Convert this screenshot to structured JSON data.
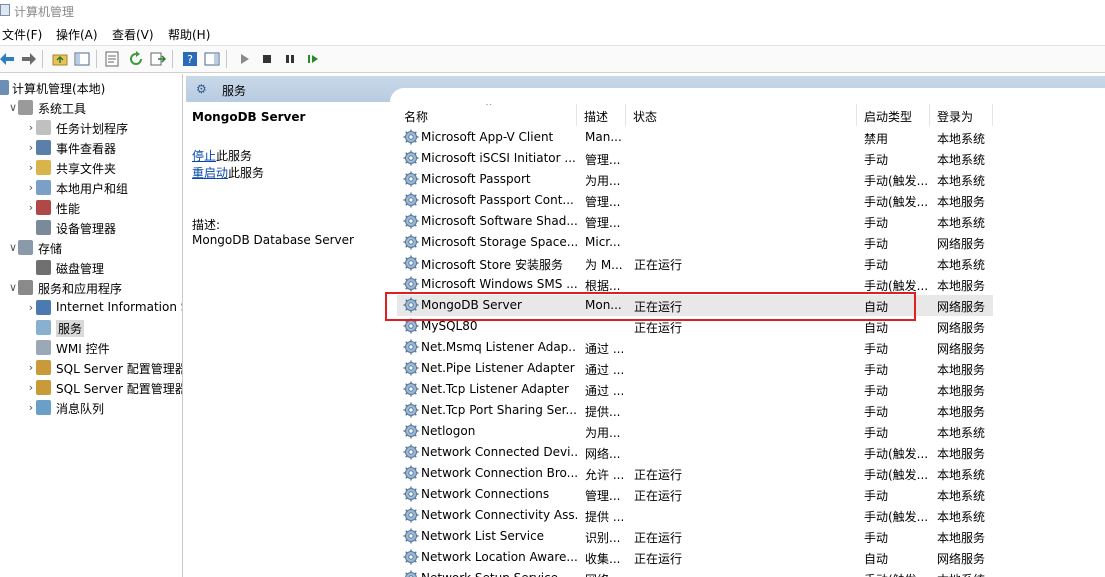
{
  "window": {
    "title": "计算机管理"
  },
  "menu": [
    "文件(F)",
    "操作(A)",
    "查看(V)",
    "帮助(H)"
  ],
  "tree": [
    {
      "label": "计算机管理(本地)",
      "level": 0,
      "arrow": "",
      "icon": "computer-icon"
    },
    {
      "label": "系统工具",
      "level": 1,
      "arrow": "∨",
      "icon": "tools-icon"
    },
    {
      "label": "任务计划程序",
      "level": 2,
      "arrow": "›",
      "icon": "clock-icon"
    },
    {
      "label": "事件查看器",
      "level": 2,
      "arrow": "›",
      "icon": "event-viewer-icon"
    },
    {
      "label": "共享文件夹",
      "level": 2,
      "arrow": "›",
      "icon": "shared-folder-icon"
    },
    {
      "label": "本地用户和组",
      "level": 2,
      "arrow": "›",
      "icon": "users-icon"
    },
    {
      "label": "性能",
      "level": 2,
      "arrow": "›",
      "icon": "performance-icon"
    },
    {
      "label": "设备管理器",
      "level": 2,
      "arrow": "",
      "icon": "device-manager-icon"
    },
    {
      "label": "存储",
      "level": 1,
      "arrow": "∨",
      "icon": "storage-icon"
    },
    {
      "label": "磁盘管理",
      "level": 2,
      "arrow": "",
      "icon": "disk-icon"
    },
    {
      "label": "服务和应用程序",
      "level": 1,
      "arrow": "∨",
      "icon": "services-apps-icon"
    },
    {
      "label": "Internet Information S",
      "level": 2,
      "arrow": "›",
      "icon": "iis-icon"
    },
    {
      "label": "服务",
      "level": 2,
      "arrow": "",
      "icon": "services-gear-icon",
      "selected": true
    },
    {
      "label": "WMI 控件",
      "level": 2,
      "arrow": "",
      "icon": "wmi-icon"
    },
    {
      "label": "SQL Server 配置管理器",
      "level": 2,
      "arrow": "›",
      "icon": "sql-config-icon"
    },
    {
      "label": "SQL Server 配置管理器",
      "level": 2,
      "arrow": "›",
      "icon": "sql-config-icon"
    },
    {
      "label": "消息队列",
      "level": 2,
      "arrow": "›",
      "icon": "message-queue-icon"
    }
  ],
  "content_header": {
    "title": "服务"
  },
  "detail": {
    "service_name": "MongoDB Server",
    "stop_link": "停止",
    "stop_suffix": "此服务",
    "restart_link": "重启动",
    "restart_suffix": "此服务",
    "desc_label": "描述:",
    "desc_text": "MongoDB Database Server"
  },
  "columns": {
    "name": "名称",
    "description": "描述",
    "status": "状态",
    "startup": "启动类型",
    "logon": "登录为"
  },
  "services": [
    {
      "name": "Microsoft App-V Client",
      "desc": "Man...",
      "status": "",
      "startup": "禁用",
      "logon": "本地系统"
    },
    {
      "name": "Microsoft iSCSI Initiator ...",
      "desc": "管理...",
      "status": "",
      "startup": "手动",
      "logon": "本地系统"
    },
    {
      "name": "Microsoft Passport",
      "desc": "为用...",
      "status": "",
      "startup": "手动(触发...",
      "logon": "本地系统"
    },
    {
      "name": "Microsoft Passport Cont...",
      "desc": "管理...",
      "status": "",
      "startup": "手动(触发...",
      "logon": "本地服务"
    },
    {
      "name": "Microsoft Software Shad...",
      "desc": "管理...",
      "status": "",
      "startup": "手动",
      "logon": "本地系统"
    },
    {
      "name": "Microsoft Storage Space...",
      "desc": "Micr...",
      "status": "",
      "startup": "手动",
      "logon": "网络服务"
    },
    {
      "name": "Microsoft Store 安装服务",
      "desc": "为 M...",
      "status": "正在运行",
      "startup": "手动",
      "logon": "本地系统"
    },
    {
      "name": "Microsoft Windows SMS ...",
      "desc": "根据...",
      "status": "",
      "startup": "手动(触发...",
      "logon": "本地服务"
    },
    {
      "name": "MongoDB Server",
      "desc": "Mon...",
      "status": "正在运行",
      "startup": "自动",
      "logon": "网络服务",
      "selected": true
    },
    {
      "name": "MySQL80",
      "desc": "",
      "status": "正在运行",
      "startup": "自动",
      "logon": "网络服务"
    },
    {
      "name": "Net.Msmq Listener Adap...",
      "desc": "通过 ...",
      "status": "",
      "startup": "手动",
      "logon": "网络服务"
    },
    {
      "name": "Net.Pipe Listener Adapter",
      "desc": "通过 ...",
      "status": "",
      "startup": "手动",
      "logon": "本地服务"
    },
    {
      "name": "Net.Tcp Listener Adapter",
      "desc": "通过 ...",
      "status": "",
      "startup": "手动",
      "logon": "本地服务"
    },
    {
      "name": "Net.Tcp Port Sharing Ser...",
      "desc": "提供...",
      "status": "",
      "startup": "手动",
      "logon": "本地服务"
    },
    {
      "name": "Netlogon",
      "desc": "为用...",
      "status": "",
      "startup": "手动",
      "logon": "本地系统"
    },
    {
      "name": "Network Connected Devi...",
      "desc": "网络...",
      "status": "",
      "startup": "手动(触发...",
      "logon": "本地服务"
    },
    {
      "name": "Network Connection Bro...",
      "desc": "允许 ...",
      "status": "正在运行",
      "startup": "手动(触发...",
      "logon": "本地系统"
    },
    {
      "name": "Network Connections",
      "desc": "管理...",
      "status": "正在运行",
      "startup": "手动",
      "logon": "本地系统"
    },
    {
      "name": "Network Connectivity Ass...",
      "desc": "提供 ...",
      "status": "",
      "startup": "手动(触发...",
      "logon": "本地系统"
    },
    {
      "name": "Network List Service",
      "desc": "识别...",
      "status": "正在运行",
      "startup": "手动",
      "logon": "本地服务"
    },
    {
      "name": "Network Location Aware...",
      "desc": "收集...",
      "status": "正在运行",
      "startup": "自动",
      "logon": "网络服务"
    },
    {
      "name": "Network Setup Service",
      "desc": "网络...",
      "status": "",
      "startup": "手动(触发...",
      "logon": "本地系统"
    }
  ]
}
